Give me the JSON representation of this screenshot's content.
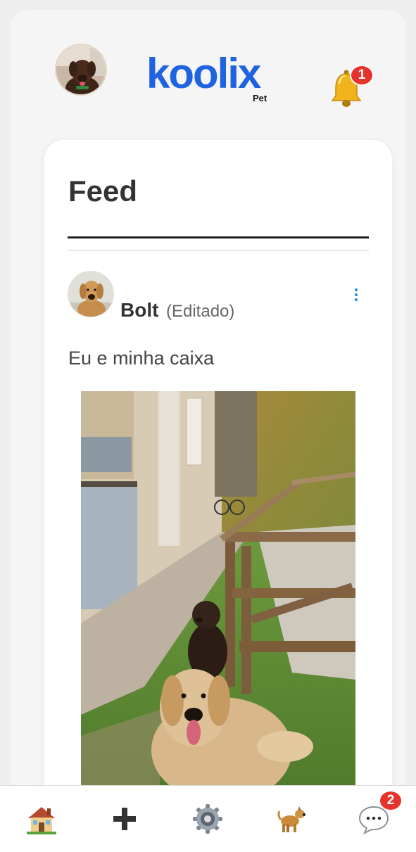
{
  "header": {
    "logo_text": "koolix",
    "logo_subtext": "Pet",
    "notifications_count": "1"
  },
  "feed": {
    "title": "Feed"
  },
  "post": {
    "author": "Bolt",
    "edited_label": "(Editado)",
    "text": "Eu e minha caixa"
  },
  "bottom_nav": {
    "items": [
      {
        "icon": "home-icon"
      },
      {
        "icon": "plus-icon"
      },
      {
        "icon": "gear-icon"
      },
      {
        "icon": "dog-icon"
      },
      {
        "icon": "chat-bubble-icon"
      }
    ],
    "messages_count": "2"
  },
  "colors": {
    "brand": "#1f63e0",
    "badge": "#e5322d",
    "menu_dots": "#1a8be0"
  }
}
